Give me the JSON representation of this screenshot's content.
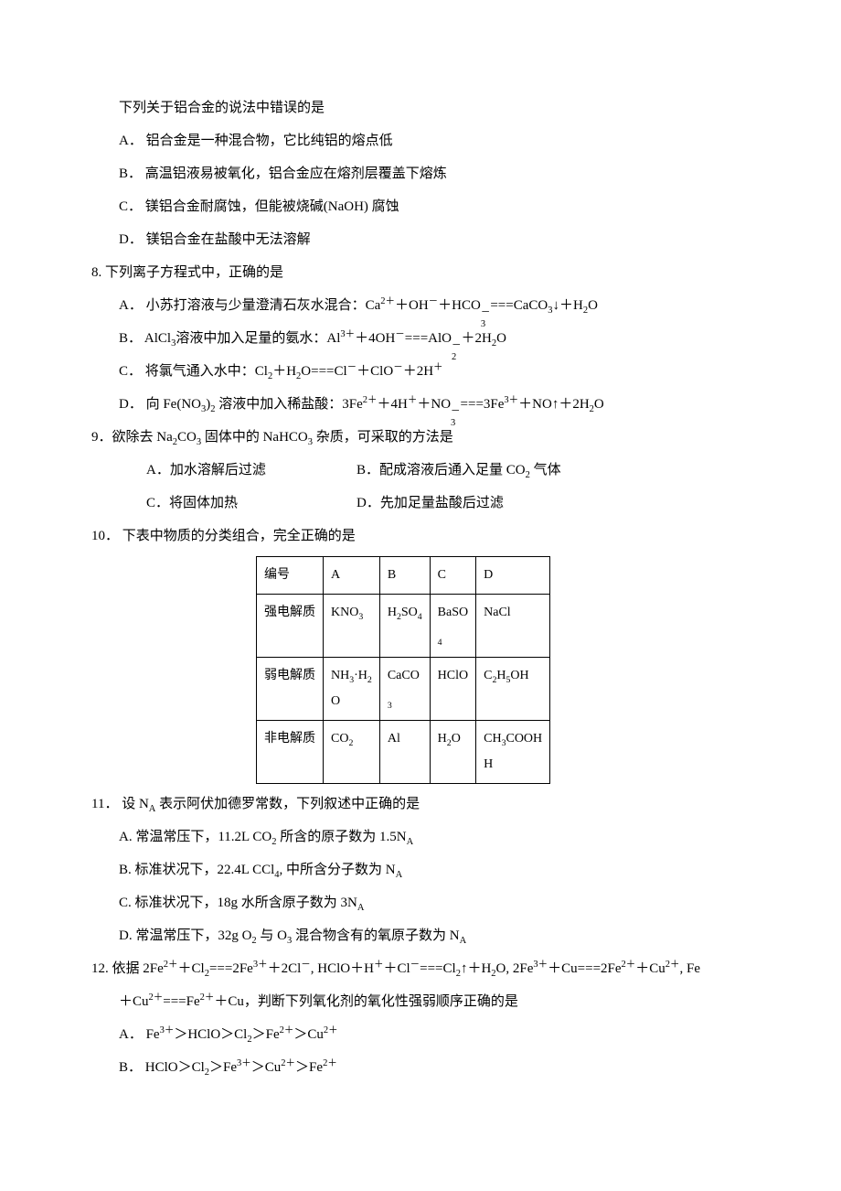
{
  "q7": {
    "stem": "下列关于铝合金的说法中错误的是",
    "A": "A．  铝合金是一种混合物，它比纯铝的熔点低",
    "B": "B．  高温铝液易被氧化，铝合金应在熔剂层覆盖下熔炼",
    "C": "C．  镁铝合金耐腐蚀，但能被烧碱(NaOH) 腐蚀",
    "D": "D．  镁铝合金在盐酸中无法溶解"
  },
  "q8": {
    "stem": "8. 下列离子方程式中，正确的是",
    "A_pre": "A．  小苏打溶液与少量澄清石灰水混合：Ca",
    "A_mid": "＋OH",
    "A_mid2": "＋HCO",
    "A_post": "===CaCO",
    "A_tail": "↓＋H",
    "B_pre": "B．  AlCl",
    "B_mid": "溶液中加入足量的氨水：Al",
    "B_mid2": "＋4OH",
    "B_mid3": "===AlO",
    "B_tail": "＋2H",
    "C_pre": "C．  将氯气通入水中：Cl",
    "C_mid": "＋H",
    "C_mid2": "O===Cl",
    "C_mid3": "＋ClO",
    "C_tail": "＋2H",
    "D_pre": "D．  向 Fe(NO",
    "D_mid": " 溶液中加入稀盐酸：3Fe",
    "D_mid2": "＋4H",
    "D_mid3": "＋NO",
    "D_mid4": "===3Fe",
    "D_tail": "＋NO↑＋2H"
  },
  "q9": {
    "stem_pre": "9．欲除去 Na",
    "stem_mid": "CO",
    "stem_mid2": " 固体中的 NaHCO",
    "stem_post": " 杂质，可采取的方法是",
    "A": "A．加水溶解后过滤",
    "B_pre": "B．配成溶液后通入足量 CO",
    "B_post": " 气体",
    "C": "C．将固体加热",
    "D": "D．先加足量盐酸后过滤"
  },
  "q10": {
    "stem": "10．  下表中物质的分类组合，完全正确的是",
    "header": [
      "编号",
      "A",
      "B",
      "C",
      "D"
    ],
    "row1_label": "强电解质",
    "row1": {
      "A_pre": "KNO",
      "A_sub": "3",
      "B_pre": "H",
      "B_sub": "2",
      "B_mid": "SO",
      "B_sub2": "4",
      "C_pre": "BaSO",
      "C_sub": "4",
      "D": "NaCl"
    },
    "row2_label": "弱电解质",
    "row2": {
      "A_pre": "NH",
      "A_sub": "3",
      "A_mid": "·H",
      "A_sub2": "2",
      "A_post": "O",
      "B_pre": "CaCO",
      "B_sub": "3",
      "C": "HClO",
      "D_pre": "C",
      "D_sub": "2",
      "D_mid": "H",
      "D_sub2": "5",
      "D_post": "OH"
    },
    "row3_label": "非电解质",
    "row3": {
      "A_pre": "CO",
      "A_sub": "2",
      "B": "Al",
      "C_pre": "H",
      "C_sub": "2",
      "C_post": "O",
      "D_pre": "CH",
      "D_sub": "3",
      "D_post": "COOH"
    }
  },
  "q11": {
    "stem_pre": "11．  设 N",
    "stem_post": " 表示阿伏加德罗常数，下列叙述中正确的是",
    "A_pre": "A. 常温常压下，11.2L CO",
    "A_mid": " 所含的原子数为 1.5N",
    "B_pre": "B. 标准状况下，22.4L CCl",
    "B_mid": ", 中所含分子数为 N",
    "C_pre": "C. 标准状况下，18g 水所含原子数为 3N",
    "D_pre": "D. 常温常压下，32g O",
    "D_mid": " 与 O",
    "D_mid2": " 混合物含有的氧原子数为 N"
  },
  "q12": {
    "stem_pre": "12. 依据 2Fe",
    "stem_1": "＋Cl",
    "stem_2": "===2Fe",
    "stem_3": "＋2Cl",
    "stem_4": ", HClO＋H",
    "stem_5": "＋Cl",
    "stem_6": "===Cl",
    "stem_7": "↑＋H",
    "stem_8": "O, 2Fe",
    "stem_9": "＋Cu===2Fe",
    "stem_10": "＋Cu",
    "stem_11": ", Fe",
    "line2_pre": "＋Cu",
    "line2_1": "===Fe",
    "line2_2": "＋Cu，判断下列氧化剂的氧化性强弱顺序正确的是",
    "A_pre": "A．  Fe",
    "A_1": "＞HClO＞Cl",
    "A_2": "＞Fe",
    "A_3": "＞Cu",
    "B_pre": "B．  HClO＞Cl",
    "B_1": "＞Fe",
    "B_2": "＞Cu",
    "B_3": "＞Fe"
  }
}
